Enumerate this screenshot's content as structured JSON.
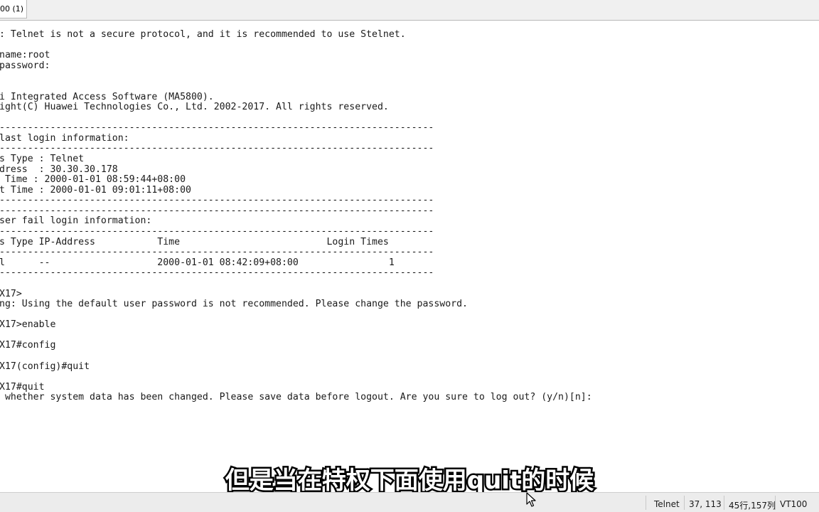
{
  "tab": {
    "label": "00 (1)"
  },
  "terminal": {
    "lines": [
      ": Telnet is not a secure protocol, and it is recommended to use Stelnet.",
      "",
      "name:root",
      "password:",
      "",
      "",
      "i Integrated Access Software (MA5800).",
      "ight(C) Huawei Technologies Co., Ltd. 2002-2017. All rights reserved.",
      "",
      "-----------------------------------------------------------------------------",
      "last login information:",
      "-----------------------------------------------------------------------------",
      "s Type : Telnet",
      "dress  : 30.30.30.178",
      " Time : 2000-01-01 08:59:44+08:00",
      "t Time : 2000-01-01 09:01:11+08:00",
      "-----------------------------------------------------------------------------",
      "-----------------------------------------------------------------------------",
      "ser fail login information:",
      "-----------------------------------------------------------------------------",
      "s Type IP-Address           Time                          Login Times",
      "-----------------------------------------------------------------------------",
      "l      --                   2000-01-01 08:42:09+08:00                1",
      "-----------------------------------------------------------------------------",
      "",
      "X17>",
      "ng: Using the default user password is not recommended. Please change the password.",
      "",
      "X17>enable",
      "",
      "X17#config",
      "",
      "X17(config)#quit",
      "",
      "X17#quit",
      " whether system data has been changed. Please save data before logout. Are you sure to log out? (y/n)[n]:"
    ]
  },
  "subtitle": {
    "text": "但是当在特权下面使用quit的时候"
  },
  "status_bar": {
    "protocol": "Telnet",
    "cursor_position": "37, 113",
    "dimensions": "45行,157列",
    "terminal_type": "VT100"
  },
  "colors": {
    "terminal_text": "#1a1a1a",
    "terminal_bg": "#ffffff",
    "status_bg": "#ececec",
    "tab_strip_bg": "#f0f0f0"
  }
}
